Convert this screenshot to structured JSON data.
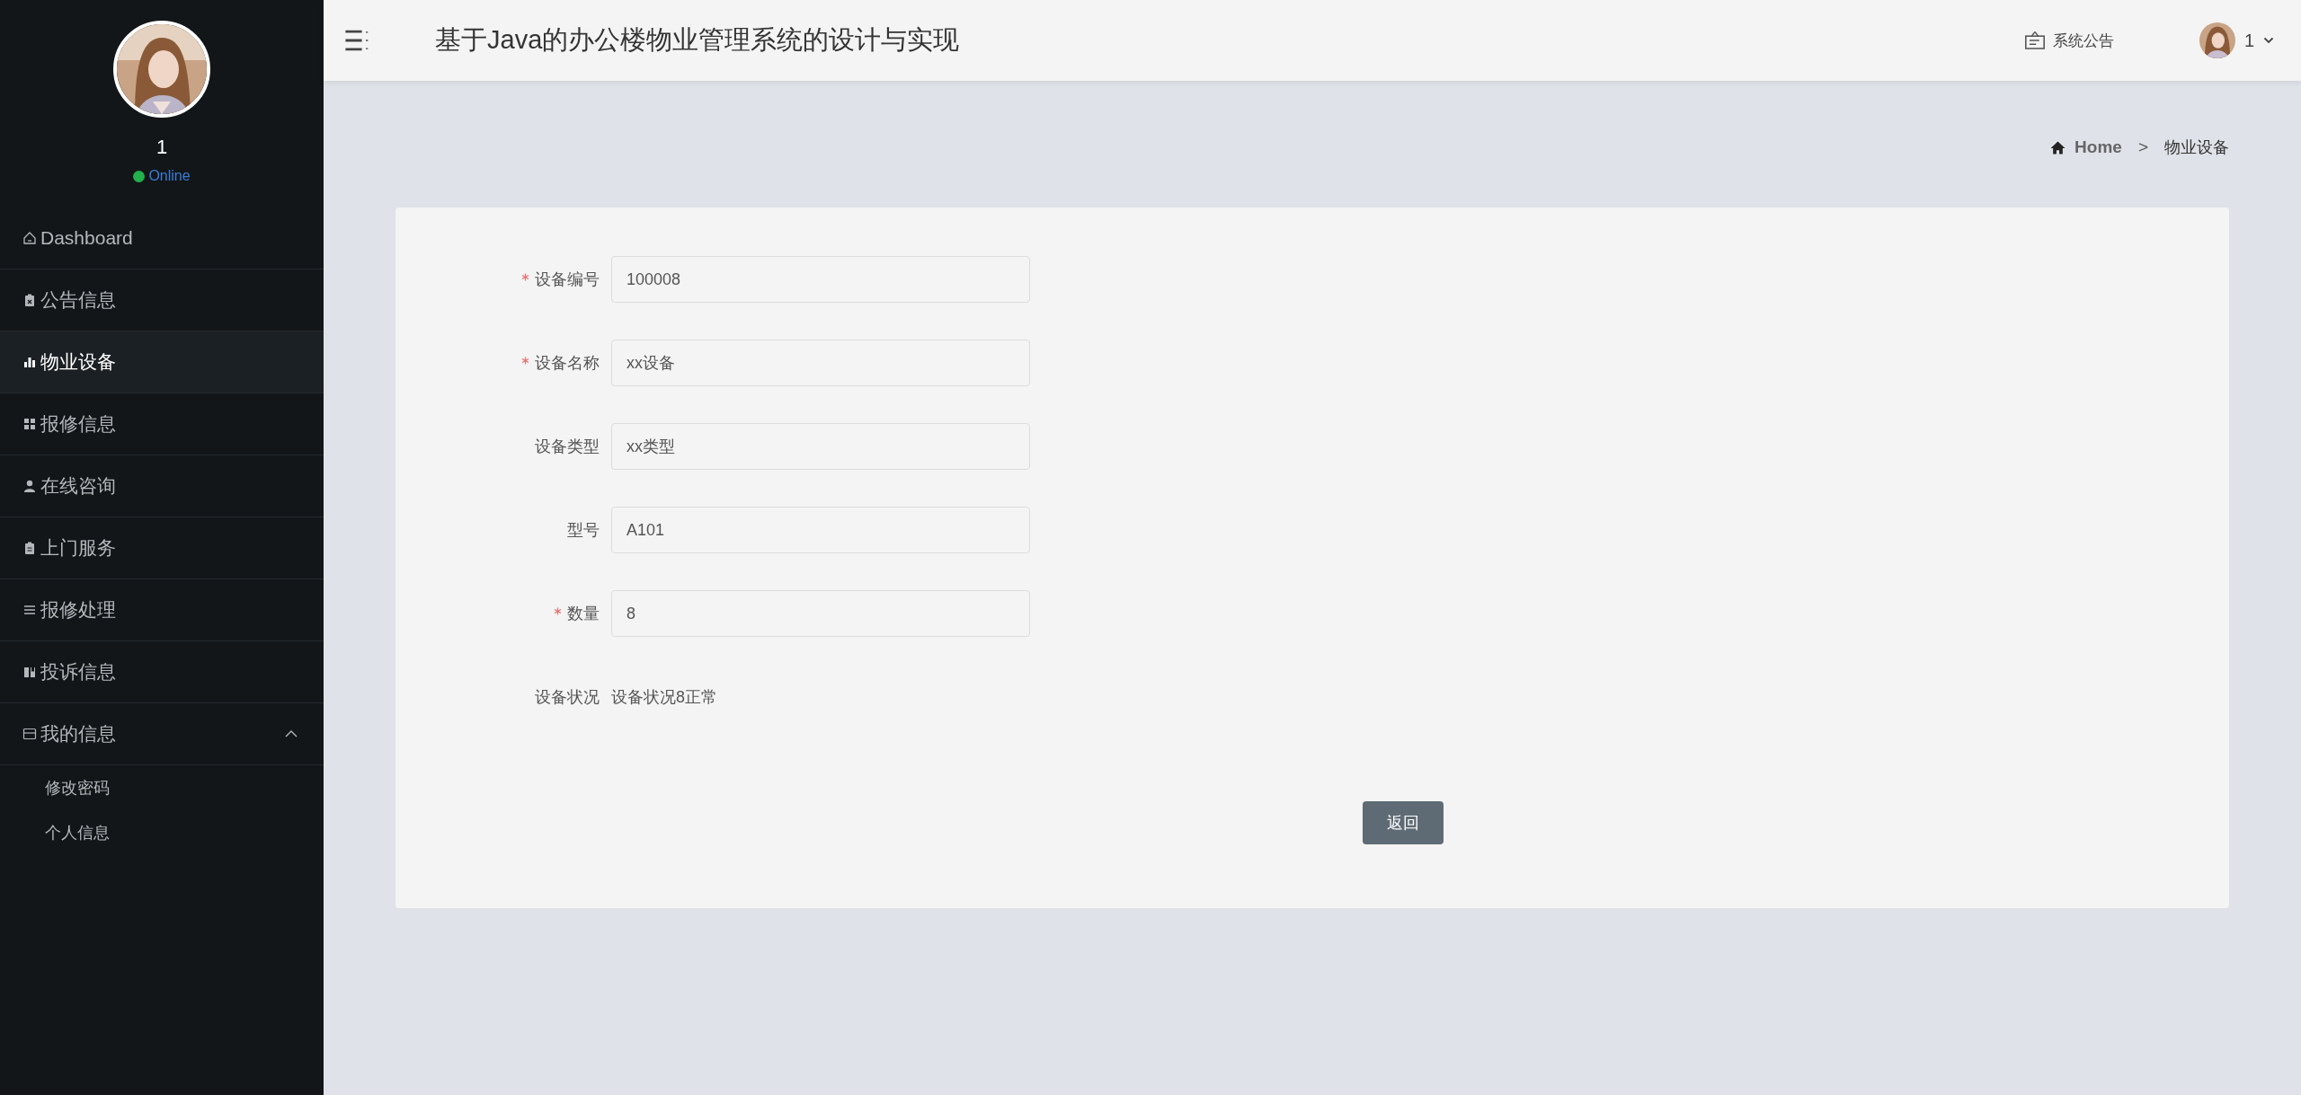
{
  "sidebar": {
    "user_name": "1",
    "status": {
      "label": "Online",
      "color": "#22b14c"
    },
    "menu": [
      {
        "label": "Dashboard",
        "selected": false
      },
      {
        "label": "公告信息",
        "selected": false
      },
      {
        "label": "物业设备",
        "selected": true
      },
      {
        "label": "报修信息",
        "selected": false
      },
      {
        "label": "在线咨询",
        "selected": false
      },
      {
        "label": "上门服务",
        "selected": false
      },
      {
        "label": "报修处理",
        "selected": false
      },
      {
        "label": "投诉信息",
        "selected": false
      },
      {
        "label": "我的信息",
        "selected": false,
        "expanded": true,
        "children": [
          {
            "label": "修改密码",
            "selected": false
          },
          {
            "label": "个人信息",
            "selected": false
          }
        ]
      }
    ]
  },
  "header": {
    "title": "基于Java的办公楼物业管理系统的设计与实现",
    "notice": "系统公告",
    "user": "1"
  },
  "breadcrumb": {
    "home": "Home",
    "separator": ">",
    "current": "物业设备"
  },
  "form": {
    "fields": [
      {
        "label": "设备编号",
        "required": true,
        "kind": "input",
        "value": "100008"
      },
      {
        "label": "设备名称",
        "required": true,
        "kind": "input",
        "value": "xx设备"
      },
      {
        "label": "设备类型",
        "required": false,
        "kind": "input",
        "value": "xx类型"
      },
      {
        "label": "型号",
        "required": false,
        "kind": "input",
        "value": "A101"
      },
      {
        "label": "数量",
        "required": true,
        "kind": "input",
        "value": "8"
      },
      {
        "label": "设备状况",
        "required": false,
        "kind": "text",
        "value": "设备状况8正常"
      }
    ],
    "button": "返回"
  }
}
